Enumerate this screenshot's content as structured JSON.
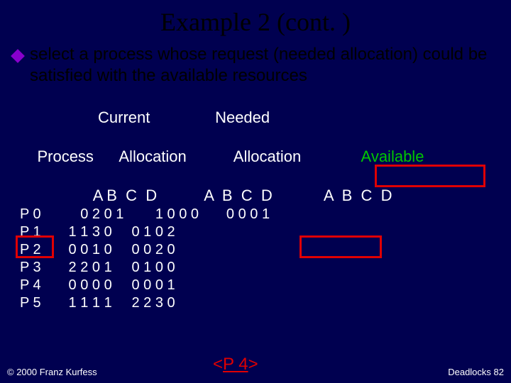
{
  "title": "Example 2 (cont. )",
  "bullet": "select a process whose request (needed allocation) could be satisfied with the available resources",
  "headers": {
    "line1": "                  Current               Needed",
    "line2_left": "Process      Allocation           Allocation              ",
    "line2_avail": "Available",
    "line3": "                 A B  C  D           A  B  C  D            A  B  C  D"
  },
  "rows": [
    "P 0          0 2 0 1        1 0 0 0       0 0 0 1",
    "P 1       1 1 3 0     0 1 0 2",
    "P 2       0 0 1 0     0 0 2 0",
    "P 3       2 2 0 1     0 1 0 0",
    "P 4       0 0 0 0     0 0 0 1",
    "P 5       1 1 1 1     2 2 3 0"
  ],
  "sequence": {
    "open": "<",
    "proc": "P 4",
    "close": ">"
  },
  "footer": {
    "copyright": "© 2000 Franz Kurfess",
    "pageref": "Deadlocks  82"
  }
}
